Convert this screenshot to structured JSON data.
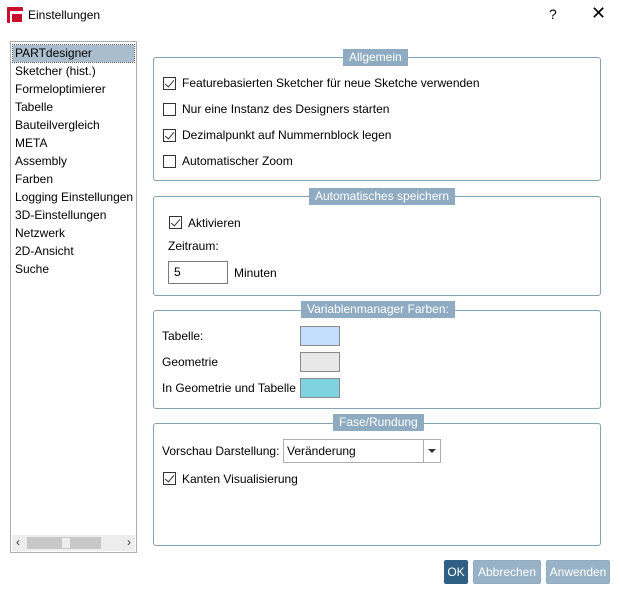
{
  "window": {
    "title": "Einstellungen",
    "help": "?",
    "close": "✕"
  },
  "sidebar": {
    "items": [
      "PARTdesigner",
      "Sketcher (hist.)",
      "Formeloptimierer",
      "Tabelle",
      "Bauteilvergleich",
      "META",
      "Assembly",
      "Farben",
      "Logging Einstellungen",
      "3D-Einstellungen",
      "Netzwerk",
      "2D-Ansicht",
      "Suche"
    ],
    "selected": "PARTdesigner",
    "scroll_left": "‹",
    "scroll_right": "›"
  },
  "allgemein": {
    "legend": "Allgemein",
    "options": [
      {
        "label": "Featurebasierten Sketcher für neue Sketche verwenden",
        "checked": true
      },
      {
        "label": "Nur eine Instanz des Designers starten",
        "checked": false
      },
      {
        "label": "Dezimalpunkt auf Nummernblock legen",
        "checked": true
      },
      {
        "label": "Automatischer Zoom",
        "checked": false
      }
    ]
  },
  "autosave": {
    "legend": "Automatisches speichern",
    "activate_label": "Aktivieren",
    "activate_checked": true,
    "period_label": "Zeitraum:",
    "period_value": "5",
    "unit": "Minuten"
  },
  "varcolors": {
    "legend": "Variablenmanager Farben:",
    "rows": [
      {
        "label": "Tabelle:",
        "color": "#c2e0fe"
      },
      {
        "label": "Geometrie",
        "color": "#e8e8e8"
      },
      {
        "label": "In Geometrie und Tabelle",
        "color": "#7fd3e0"
      }
    ]
  },
  "fase": {
    "legend": "Fase/Rundung",
    "preview_label": "Vorschau Darstellung:",
    "preview_value": "Veränderung",
    "edges_label": "Kanten Visualisierung",
    "edges_checked": true
  },
  "buttons": {
    "ok": "OK",
    "cancel": "Abbrechen",
    "apply": "Anwenden"
  }
}
